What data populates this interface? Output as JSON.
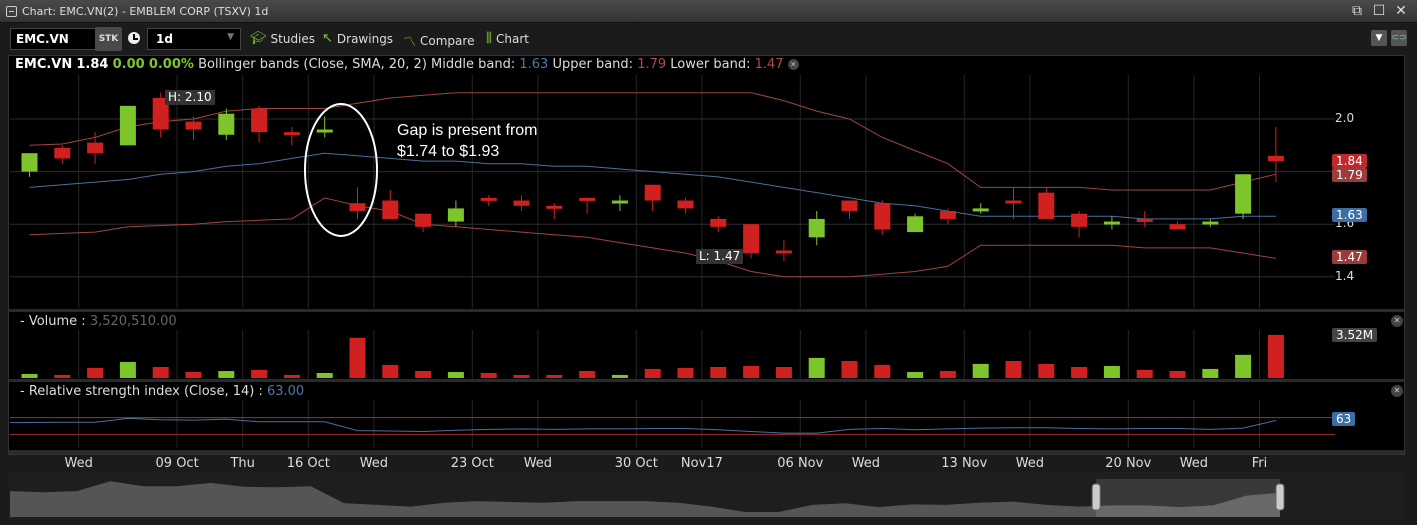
{
  "window": {
    "title": "Chart: EMC.VN(2) - EMBLEM CORP (TSXV) 1d",
    "buttons": [
      "popout-icon",
      "maximize-icon",
      "close-icon"
    ]
  },
  "toolbar": {
    "symbol": "EMC.VN",
    "type": "STK",
    "period": "1d",
    "studies": "Studies",
    "drawings": "Drawings",
    "compare": "Compare",
    "chart": "Chart"
  },
  "legend": {
    "symbol": "EMC.VN",
    "last": "1.84",
    "change": "0.00",
    "change_pct": "0.00%",
    "study": "Bollinger bands (Close, SMA, 20, 2)",
    "middle_label": "Middle band:",
    "middle": "1.63",
    "upper_label": "Upper band:",
    "upper": "1.79",
    "lower_label": "Lower band:",
    "lower": "1.47"
  },
  "annotation": {
    "line1": "Gap is present from",
    "line2": "$1.74 to $1.93",
    "high": "H: 2.10",
    "low": "L: 1.47"
  },
  "badges": {
    "close": "1.84",
    "upper": "1.79",
    "middle": "1.63",
    "lower": "1.47",
    "volume": "3.52M",
    "rsi": "63"
  },
  "volume_panel": {
    "title": "- Volume :",
    "value": "3,520,510.00"
  },
  "rsi_panel": {
    "title": "- Relative strength index (Close, 14) :",
    "value": "63.00"
  },
  "colors": {
    "up": "#7dc52b",
    "down": "#d0201f",
    "band": "#a0443f",
    "middle": "#4a6fa0",
    "close_badge": "#c0282a",
    "band_badge": "#9b3b3b",
    "middle_badge": "#3a6ea5"
  },
  "chart_data": {
    "type": "candlestick",
    "price_ticks": [
      "2.0",
      "1.8",
      "1.6",
      "1.4"
    ],
    "price_tick_labels": [
      "2.0",
      "1.6",
      "1.4"
    ],
    "ylim": [
      1.34,
      2.14
    ],
    "x_ticks": [
      {
        "label": "Wed",
        "at": 1.5
      },
      {
        "label": "09 Oct",
        "at": 4.5
      },
      {
        "label": "Thu",
        "at": 6.5
      },
      {
        "label": "16 Oct",
        "at": 8.5
      },
      {
        "label": "Wed",
        "at": 10.5
      },
      {
        "label": "23 Oct",
        "at": 13.5
      },
      {
        "label": "Wed",
        "at": 15.5
      },
      {
        "label": "30 Oct",
        "at": 18.5
      },
      {
        "label": "Nov17",
        "at": 20.5
      },
      {
        "label": "06 Nov",
        "at": 23.5
      },
      {
        "label": "Wed",
        "at": 25.5
      },
      {
        "label": "13 Nov",
        "at": 28.5
      },
      {
        "label": "Wed",
        "at": 30.5
      },
      {
        "label": "20 Nov",
        "at": 33.5
      },
      {
        "label": "Wed",
        "at": 35.5
      },
      {
        "label": "Fri",
        "at": 37.5
      }
    ],
    "ohlc": [
      [
        1.8,
        1.87,
        1.78,
        1.87
      ],
      [
        1.89,
        1.9,
        1.83,
        1.85
      ],
      [
        1.91,
        1.95,
        1.83,
        1.87
      ],
      [
        1.9,
        2.05,
        1.9,
        2.05
      ],
      [
        2.08,
        2.1,
        1.93,
        1.96
      ],
      [
        1.99,
        2.01,
        1.92,
        1.96
      ],
      [
        1.94,
        2.04,
        1.92,
        2.02
      ],
      [
        2.04,
        2.05,
        1.91,
        1.95
      ],
      [
        1.95,
        1.97,
        1.9,
        1.94
      ],
      [
        1.95,
        2.01,
        1.93,
        1.96
      ],
      [
        1.68,
        1.74,
        1.62,
        1.65
      ],
      [
        1.69,
        1.73,
        1.62,
        1.62
      ],
      [
        1.64,
        1.64,
        1.57,
        1.59
      ],
      [
        1.61,
        1.69,
        1.59,
        1.66
      ],
      [
        1.7,
        1.71,
        1.67,
        1.69
      ],
      [
        1.69,
        1.71,
        1.65,
        1.67
      ],
      [
        1.67,
        1.68,
        1.62,
        1.66
      ],
      [
        1.7,
        1.7,
        1.64,
        1.69
      ],
      [
        1.68,
        1.71,
        1.65,
        1.69
      ],
      [
        1.75,
        1.75,
        1.65,
        1.69
      ],
      [
        1.69,
        1.7,
        1.64,
        1.66
      ],
      [
        1.62,
        1.63,
        1.57,
        1.59
      ],
      [
        1.6,
        1.6,
        1.47,
        1.49
      ],
      [
        1.5,
        1.54,
        1.46,
        1.49
      ],
      [
        1.55,
        1.65,
        1.52,
        1.62
      ],
      [
        1.69,
        1.69,
        1.62,
        1.65
      ],
      [
        1.68,
        1.69,
        1.56,
        1.58
      ],
      [
        1.57,
        1.64,
        1.57,
        1.63
      ],
      [
        1.65,
        1.66,
        1.6,
        1.62
      ],
      [
        1.65,
        1.68,
        1.64,
        1.66
      ],
      [
        1.69,
        1.74,
        1.62,
        1.68
      ],
      [
        1.72,
        1.74,
        1.62,
        1.62
      ],
      [
        1.64,
        1.65,
        1.55,
        1.59
      ],
      [
        1.6,
        1.63,
        1.58,
        1.61
      ],
      [
        1.62,
        1.65,
        1.59,
        1.61
      ],
      [
        1.6,
        1.61,
        1.58,
        1.58
      ],
      [
        1.6,
        1.62,
        1.59,
        1.61
      ],
      [
        1.64,
        1.79,
        1.62,
        1.79
      ],
      [
        1.86,
        1.97,
        1.76,
        1.84
      ]
    ],
    "upper_band": [
      1.9,
      1.905,
      1.93,
      1.97,
      1.99,
      2.0,
      2.03,
      2.04,
      2.04,
      2.04,
      2.06,
      2.08,
      2.09,
      2.1,
      2.1,
      2.1,
      2.1,
      2.1,
      2.1,
      2.1,
      2.1,
      2.1,
      2.1,
      2.07,
      2.03,
      2.0,
      1.93,
      1.88,
      1.83,
      1.74,
      1.74,
      1.74,
      1.74,
      1.73,
      1.73,
      1.73,
      1.73,
      1.76,
      1.79
    ],
    "middle_band": [
      1.74,
      1.75,
      1.76,
      1.77,
      1.79,
      1.8,
      1.82,
      1.83,
      1.85,
      1.87,
      1.86,
      1.85,
      1.84,
      1.84,
      1.83,
      1.83,
      1.82,
      1.82,
      1.81,
      1.8,
      1.79,
      1.78,
      1.76,
      1.74,
      1.72,
      1.7,
      1.68,
      1.67,
      1.65,
      1.63,
      1.63,
      1.63,
      1.63,
      1.63,
      1.62,
      1.62,
      1.62,
      1.63,
      1.63
    ],
    "lower_band": [
      1.56,
      1.565,
      1.57,
      1.59,
      1.595,
      1.6,
      1.61,
      1.615,
      1.62,
      1.7,
      1.67,
      1.65,
      1.6,
      1.59,
      1.58,
      1.57,
      1.56,
      1.55,
      1.53,
      1.51,
      1.49,
      1.46,
      1.42,
      1.4,
      1.4,
      1.4,
      1.41,
      1.42,
      1.44,
      1.52,
      1.52,
      1.52,
      1.52,
      1.52,
      1.51,
      1.51,
      1.51,
      1.49,
      1.47
    ],
    "volume_millions": [
      0.33,
      0.25,
      0.82,
      1.31,
      0.9,
      0.49,
      0.57,
      0.66,
      0.25,
      0.41,
      3.28,
      1.07,
      0.57,
      0.49,
      0.41,
      0.25,
      0.25,
      0.57,
      0.25,
      0.74,
      0.82,
      0.9,
      0.98,
      0.9,
      1.64,
      1.39,
      1.07,
      0.49,
      0.57,
      1.15,
      1.39,
      1.15,
      0.9,
      0.98,
      0.66,
      0.57,
      0.74,
      1.89,
      3.52
    ],
    "volume_ylim": [
      0,
      4.0
    ],
    "rsi": [
      58,
      59,
      59,
      68,
      65,
      64,
      66,
      60,
      60,
      60,
      39,
      38,
      37,
      40,
      42,
      43,
      42,
      43,
      43,
      44,
      44,
      41,
      37,
      33,
      33,
      42,
      44,
      41,
      43,
      45,
      46,
      46,
      44,
      43,
      44,
      44,
      42,
      45,
      63
    ],
    "rsi_levels": [
      70,
      30
    ],
    "rsi_ylim": [
      0,
      100
    ],
    "navigator_selection": [
      32.5,
      38
    ]
  }
}
